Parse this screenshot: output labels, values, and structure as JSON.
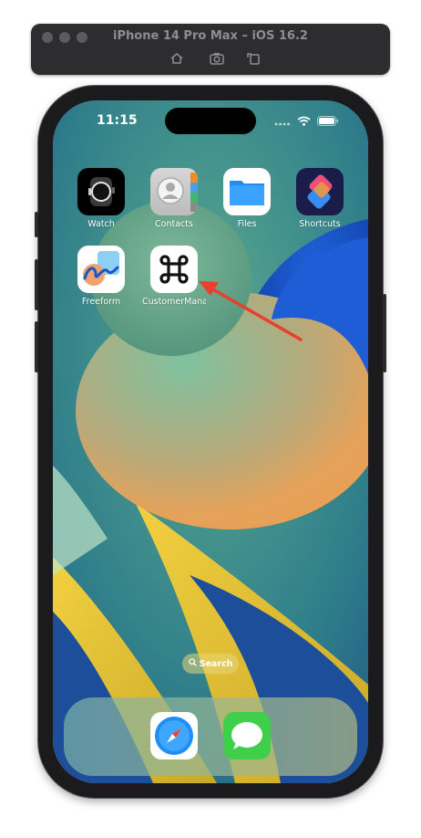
{
  "window": {
    "title": "iPhone 14 Pro Max – iOS 16.2",
    "toolbar": [
      "home-icon",
      "screenshot-icon",
      "rotate-icon"
    ]
  },
  "status_bar": {
    "time": "11:15",
    "icons": [
      "signal-icon",
      "wifi-icon",
      "battery-icon"
    ]
  },
  "apps": [
    {
      "label": "Watch",
      "icon": "watch-icon"
    },
    {
      "label": "Contacts",
      "icon": "contacts-icon"
    },
    {
      "label": "Files",
      "icon": "files-icon"
    },
    {
      "label": "Shortcuts",
      "icon": "shortcuts-icon"
    },
    {
      "label": "Freeform",
      "icon": "freeform-icon"
    },
    {
      "label": "CustomerMana...",
      "icon": "command-icon"
    }
  ],
  "search": {
    "label": "Search",
    "icon": "search-icon"
  },
  "dock": [
    {
      "name": "Safari",
      "icon": "safari-icon"
    },
    {
      "name": "Messages",
      "icon": "messages-icon"
    }
  ],
  "annotation": {
    "icon": "red-arrow-icon",
    "color": "#e8402a"
  },
  "colors": {
    "titlebar": "#2d2d2f",
    "frame": "#1b1b1d",
    "files_blue": "#1e8ef5",
    "messages_green": "#3fcf4b"
  }
}
